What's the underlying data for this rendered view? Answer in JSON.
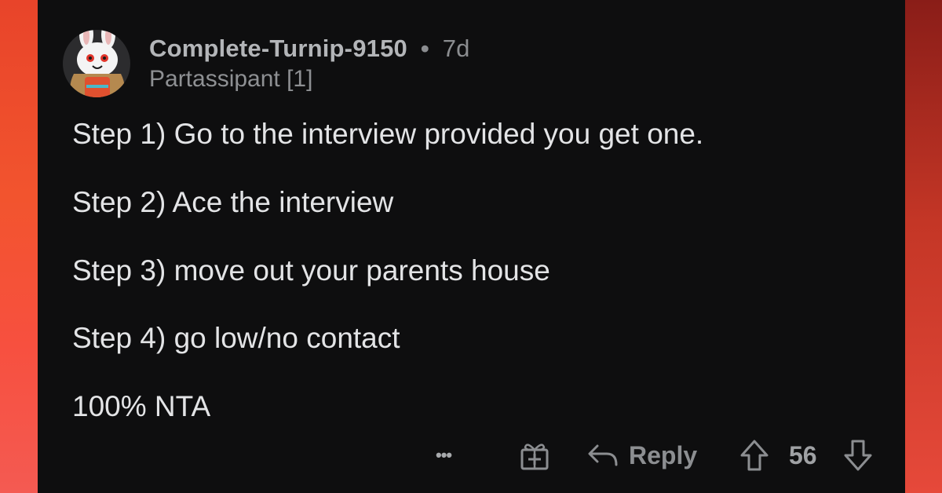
{
  "comment": {
    "author": "Complete-Turnip-9150",
    "separator": "•",
    "age": "7d",
    "flair": "Partassipant [1]",
    "lines": [
      "Step 1) Go to the interview provided you get one.",
      "Step 2) Ace the interview",
      "Step 3) move out your parents house",
      "Step 4) go low/no contact",
      "100% NTA"
    ]
  },
  "actions": {
    "more_label": "•••",
    "reply_label": "Reply",
    "vote_count": "56",
    "icons": [
      "more-icon",
      "award-icon",
      "reply-icon",
      "upvote-icon",
      "downvote-icon"
    ]
  },
  "colors": {
    "panel_bg": "#0e0e0f",
    "text": "#e3e4e6",
    "muted": "#8c8e91",
    "frame_accent": "#f2542e"
  }
}
